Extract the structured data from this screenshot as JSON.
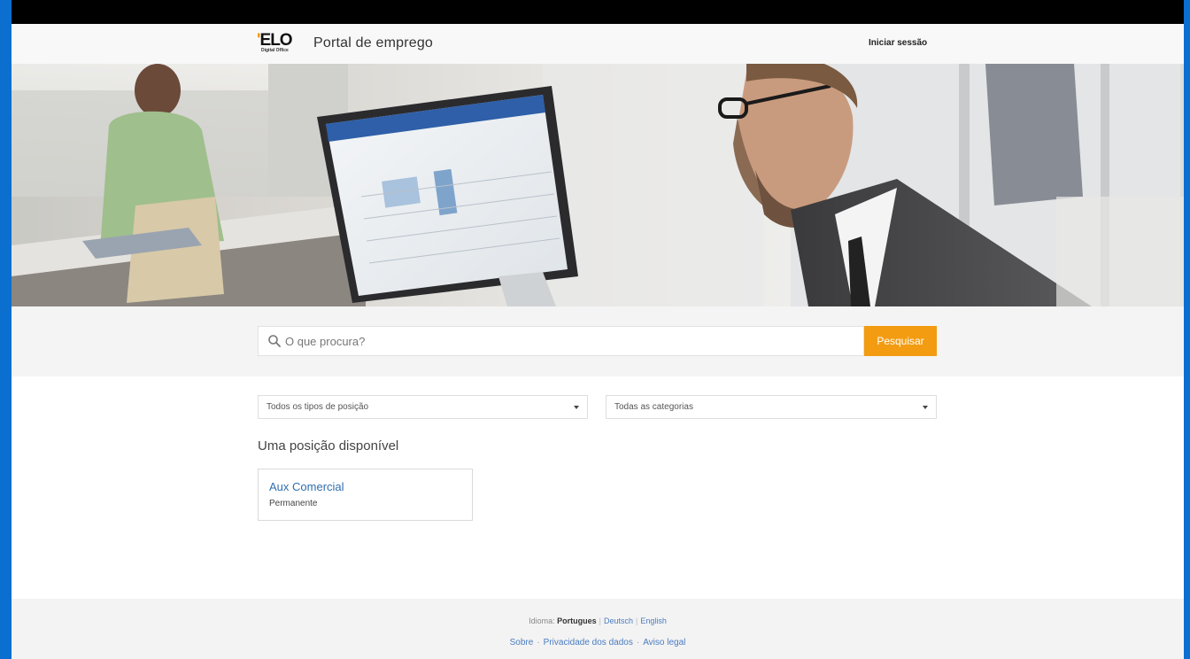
{
  "header": {
    "logo_text": "ELO",
    "logo_subtext": "Digital Office",
    "title": "Portal de emprego",
    "login_label": "Iniciar sessão"
  },
  "search": {
    "placeholder": "O que procura?",
    "value": "",
    "button_label": "Pesquisar"
  },
  "filters": {
    "position_type": "Todos os tipos de posição",
    "category": "Todas as categorias"
  },
  "results": {
    "heading": "Uma posição disponível",
    "jobs": [
      {
        "title": "Aux Comercial",
        "type": "Permanente"
      }
    ]
  },
  "footer": {
    "language_label": "Idioma:",
    "languages": [
      {
        "label": "Portugues",
        "active": true
      },
      {
        "label": "Deutsch",
        "active": false
      },
      {
        "label": "English",
        "active": false
      }
    ],
    "links": [
      "Sobre",
      "Privacidade dos dados",
      "Aviso legal"
    ]
  },
  "colors": {
    "accent": "#f39c12",
    "link": "#2f6eb0",
    "frame": "#0a6fcf"
  },
  "hero": {
    "description_icon": "office-photo"
  }
}
